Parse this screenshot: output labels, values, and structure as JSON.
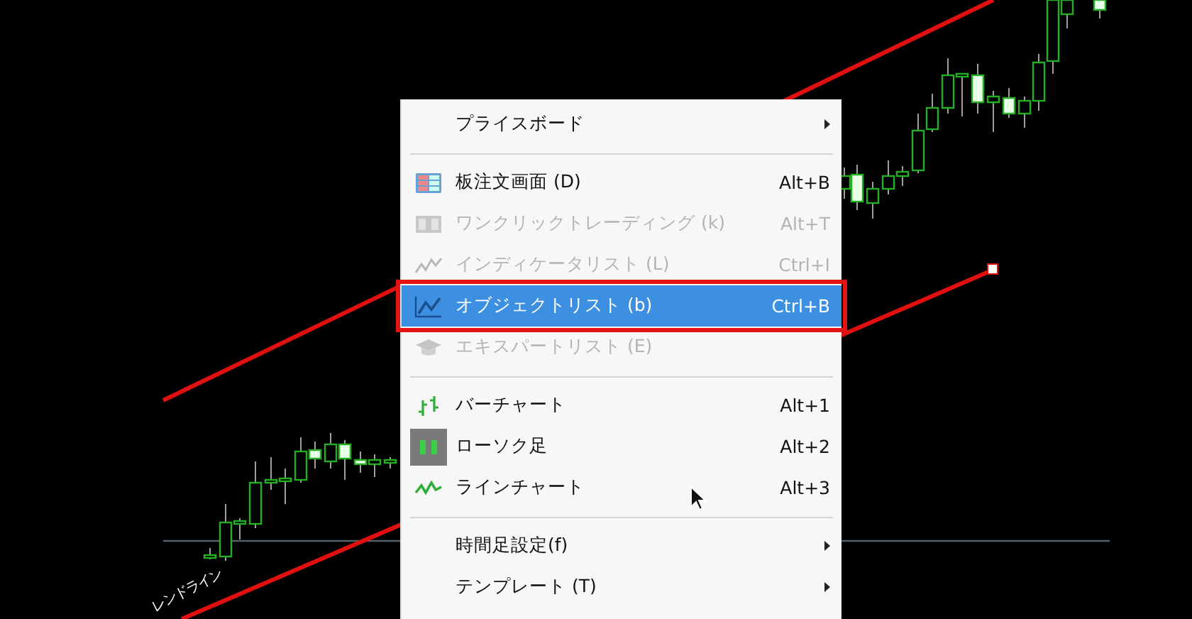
{
  "chart": {
    "line_label": "レンドライン"
  },
  "menu": {
    "items": [
      {
        "kind": "item",
        "label": "プライスボード",
        "disabled": false,
        "selected": false,
        "checked": false,
        "submenu": true
      },
      {
        "kind": "separator"
      },
      {
        "kind": "item",
        "label": "板注文画面 (D)",
        "shortcut": "Alt+B",
        "disabled": false,
        "selected": false,
        "checked": false,
        "submenu": false
      },
      {
        "kind": "item",
        "label": "ワンクリックトレーディング (k)",
        "shortcut": "Alt+T",
        "disabled": true,
        "selected": false,
        "checked": false,
        "submenu": false
      },
      {
        "kind": "item",
        "label": "インディケータリスト (L)",
        "shortcut": "Ctrl+I",
        "disabled": true,
        "selected": false,
        "checked": false,
        "submenu": false
      },
      {
        "kind": "item",
        "label": "オブジェクトリスト (b)",
        "shortcut": "Ctrl+B",
        "disabled": false,
        "selected": true,
        "checked": false,
        "submenu": false
      },
      {
        "kind": "item",
        "label": "エキスパートリスト (E)",
        "disabled": true,
        "selected": false,
        "checked": false,
        "submenu": false
      },
      {
        "kind": "separator"
      },
      {
        "kind": "item",
        "label": "バーチャート",
        "shortcut": "Alt+1",
        "disabled": false,
        "selected": false,
        "checked": false,
        "submenu": false
      },
      {
        "kind": "item",
        "label": "ローソク足",
        "shortcut": "Alt+2",
        "disabled": false,
        "selected": false,
        "checked": true,
        "submenu": false
      },
      {
        "kind": "item",
        "label": "ラインチャート",
        "shortcut": "Alt+3",
        "disabled": false,
        "selected": false,
        "checked": false,
        "submenu": false
      },
      {
        "kind": "separator"
      },
      {
        "kind": "item",
        "label": "時間足設定(f)",
        "disabled": false,
        "selected": false,
        "checked": false,
        "submenu": true
      },
      {
        "kind": "item",
        "label": "テンプレート (T)",
        "disabled": false,
        "selected": false,
        "checked": false,
        "submenu": true
      }
    ]
  }
}
